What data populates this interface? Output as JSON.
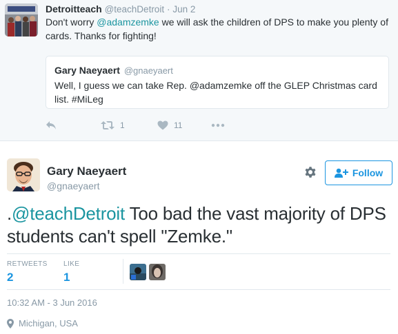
{
  "reply": {
    "name": "Detroitteach",
    "handle": "@teachDetroit",
    "separator": "·",
    "date": "Jun 2",
    "text_before": "Don't worry ",
    "mention": "@adamzemke",
    "text_after": " we will ask the children of DPS to make you plenty of cards. Thanks for fighting!",
    "quote": {
      "name": "Gary Naeyaert",
      "handle": "@gnaeyaert",
      "text": "Well, I guess we can take Rep. @adamzemke off the GLEP Christmas card list. #MiLeg"
    },
    "actions": {
      "reply_icon": "reply-arrow-icon",
      "retweet_icon": "retweet-icon",
      "retweet_count": "1",
      "like_icon": "heart-icon",
      "like_count": "11",
      "more_icon": "ellipsis-icon"
    }
  },
  "tweet": {
    "author_name": "Gary Naeyaert",
    "author_handle": "@gnaeyaert",
    "settings_icon": "gear-icon",
    "follow_label": "Follow",
    "follow_icon": "add-user-icon",
    "text_prefix": ".",
    "mention": "@teachDetroit",
    "text_body": " Too bad the vast majority of DPS students can't spell \"Zemke.\"",
    "stats": {
      "retweets_label": "RETWEETS",
      "retweets_value": "2",
      "likes_label": "LIKE",
      "likes_value": "1"
    },
    "timestamp": "10:32 AM - 3 Jun 2016",
    "location_icon": "location-pin-icon",
    "location": "Michigan, USA"
  },
  "colors": {
    "accent_blue": "#1b95e0",
    "mention_teal": "#1b95a0",
    "muted_gray": "#8899a6",
    "icon_gray": "#aab8c2",
    "reply_background": "#f5f8fa",
    "border": "#e1e8ed"
  }
}
